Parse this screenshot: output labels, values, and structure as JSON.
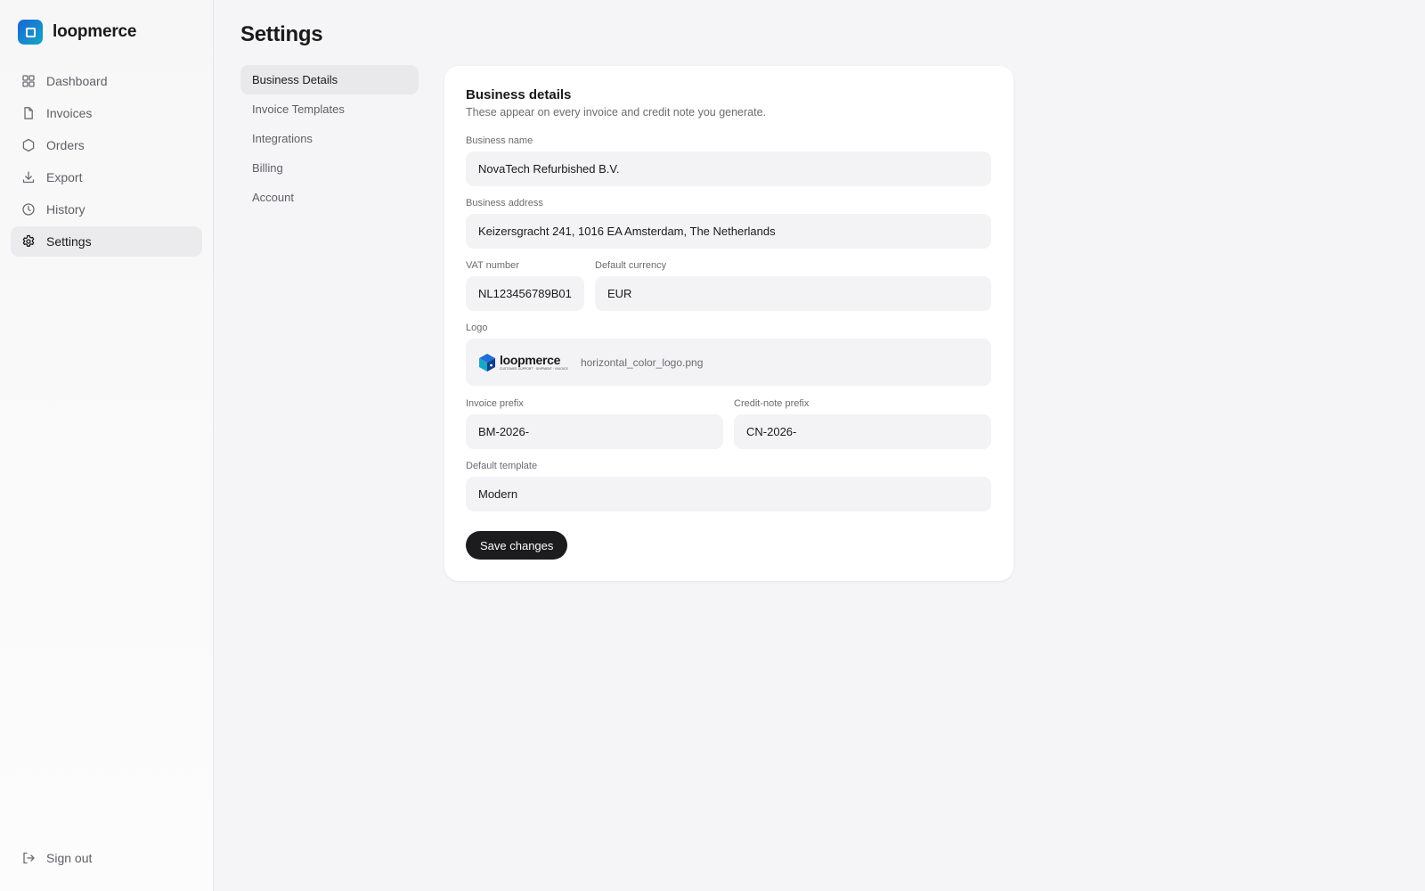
{
  "app": {
    "name": "loopmerce"
  },
  "sidebar": {
    "items": [
      {
        "label": "Dashboard",
        "icon": "grid-icon"
      },
      {
        "label": "Invoices",
        "icon": "file-icon"
      },
      {
        "label": "Orders",
        "icon": "box-icon"
      },
      {
        "label": "Export",
        "icon": "download-icon"
      },
      {
        "label": "History",
        "icon": "clock-icon"
      },
      {
        "label": "Settings",
        "icon": "gear-icon",
        "active": true
      }
    ],
    "signout_label": "Sign out"
  },
  "page": {
    "title": "Settings"
  },
  "subnav": {
    "items": [
      {
        "label": "Business Details",
        "active": true
      },
      {
        "label": "Invoice Templates"
      },
      {
        "label": "Integrations"
      },
      {
        "label": "Billing"
      },
      {
        "label": "Account"
      }
    ]
  },
  "card": {
    "title": "Business details",
    "subtitle": "These appear on every invoice and credit note you generate.",
    "fields": {
      "business_name": {
        "label": "Business name",
        "value": "NovaTech Refurbished B.V."
      },
      "business_address": {
        "label": "Business address",
        "value": "Keizersgracht 241, 1016 EA Amsterdam, The Netherlands"
      },
      "vat_number": {
        "label": "VAT number",
        "value": "NL123456789B01"
      },
      "default_currency": {
        "label": "Default currency",
        "value": "EUR"
      },
      "logo": {
        "label": "Logo",
        "wordmark": "loopmerce",
        "tagline": "CUSTOMER SUPPORT · SHIPMENT · INVOICE",
        "filename": "horizontal_color_logo.png"
      },
      "invoice_prefix": {
        "label": "Invoice prefix",
        "value": "BM-2026-"
      },
      "credit_note_prefix": {
        "label": "Credit-note prefix",
        "value": "CN-2026-"
      },
      "default_template": {
        "label": "Default template",
        "value": "Modern"
      }
    },
    "save_label": "Save changes"
  },
  "colors": {
    "accent": "#1c1c1e",
    "brand_gradient_start": "#1766d6",
    "brand_gradient_end": "#17a6c4",
    "background": "#f5f5f7"
  }
}
